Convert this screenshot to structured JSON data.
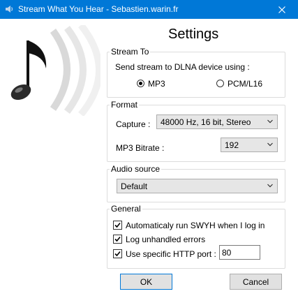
{
  "window": {
    "title": "Stream What You Hear - Sebastien.warin.fr",
    "icon": "speaker-icon",
    "close_icon": "close-icon"
  },
  "heading": "Settings",
  "stream_to": {
    "group_label": "Stream To",
    "description": "Send stream to DLNA device using :",
    "options": [
      "MP3",
      "PCM/L16"
    ],
    "selected": "MP3"
  },
  "format": {
    "group_label": "Format",
    "capture_label": "Capture :",
    "capture_value": "48000 Hz, 16 bit, Stereo",
    "bitrate_label": "MP3 Bitrate :",
    "bitrate_value": "192"
  },
  "audio_source": {
    "group_label": "Audio source",
    "value": "Default"
  },
  "general": {
    "group_label": "General",
    "autorun_label": "Automaticaly run SWYH when I log in",
    "autorun_checked": true,
    "log_label": "Log unhandled errors",
    "log_checked": true,
    "port_label": "Use specific HTTP port :",
    "port_checked": true,
    "port_value": "80"
  },
  "buttons": {
    "ok": "OK",
    "cancel": "Cancel"
  },
  "colors": {
    "titlebar": "#0078d7",
    "focus_border": "#0078d7"
  }
}
